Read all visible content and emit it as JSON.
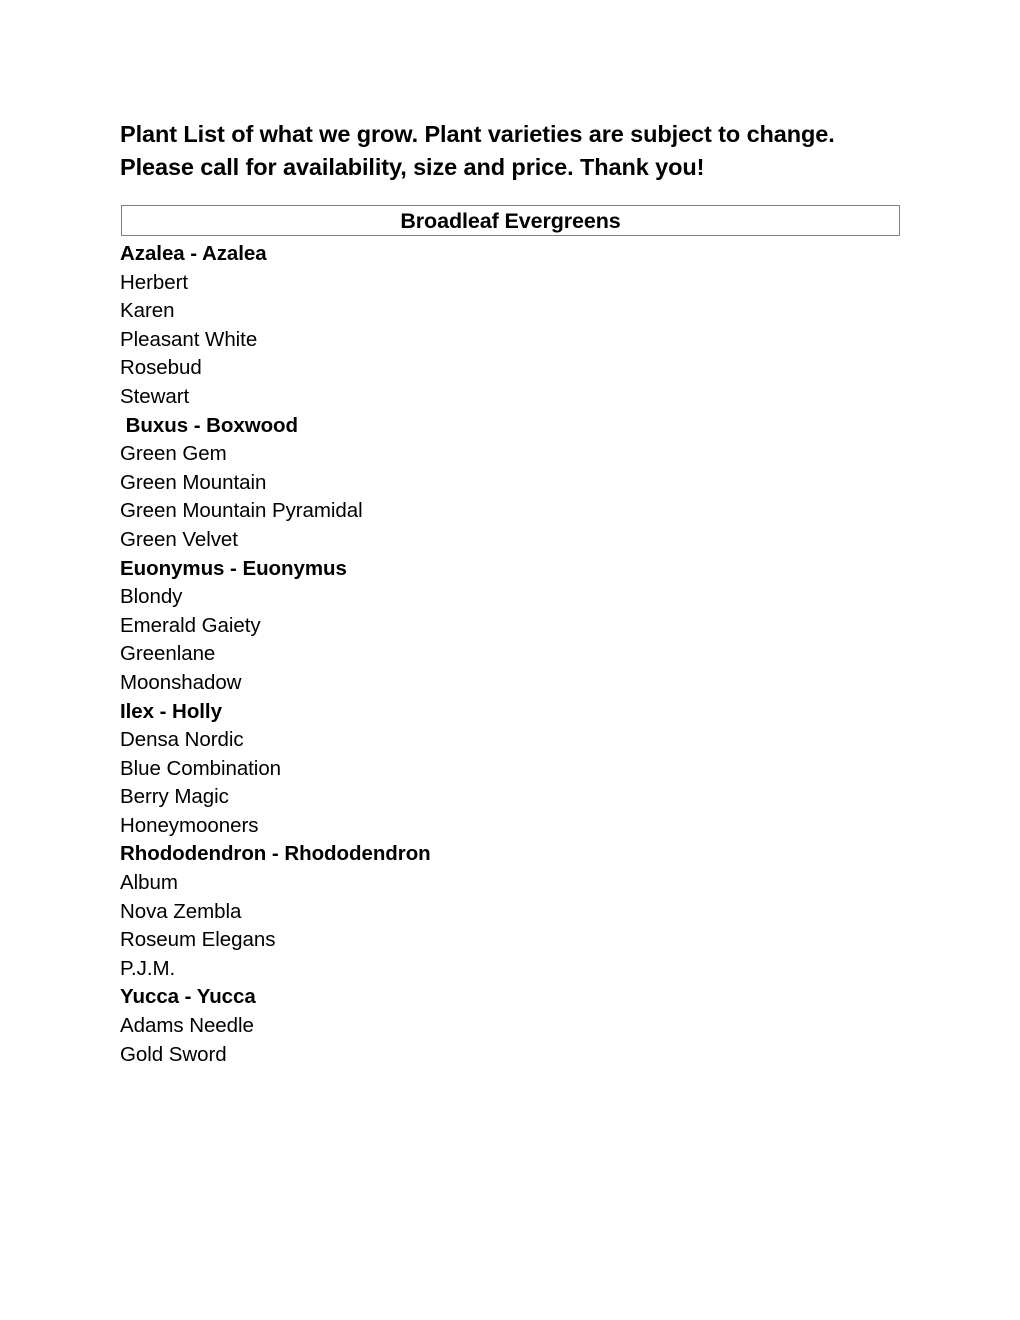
{
  "document": {
    "intro_lines": [
      "Plant List of what we grow. Plant varieties are subject to change.",
      "Please call for availability, size and price. Thank you!"
    ],
    "section_title": "Broadleaf Evergreens",
    "border_color": "#808080",
    "text_color": "#000000",
    "background_color": "#ffffff",
    "lines": [
      {
        "text": "Azalea - Azalea",
        "bold": true
      },
      {
        "text": "Herbert",
        "bold": false
      },
      {
        "text": "Karen",
        "bold": false
      },
      {
        "text": "Pleasant White",
        "bold": false
      },
      {
        "text": "Rosebud",
        "bold": false
      },
      {
        "text": "Stewart",
        "bold": false
      },
      {
        "text": " Buxus - Boxwood",
        "bold": true
      },
      {
        "text": "Green Gem",
        "bold": false
      },
      {
        "text": "Green Mountain",
        "bold": false
      },
      {
        "text": "Green Mountain Pyramidal",
        "bold": false
      },
      {
        "text": "Green Velvet",
        "bold": false
      },
      {
        "text": "Euonymus - Euonymus",
        "bold": true
      },
      {
        "text": "Blondy",
        "bold": false
      },
      {
        "text": "Emerald Gaiety",
        "bold": false
      },
      {
        "text": "Greenlane",
        "bold": false
      },
      {
        "text": "Moonshadow",
        "bold": false
      },
      {
        "text": "Ilex - Holly",
        "bold": true
      },
      {
        "text": "Densa Nordic",
        "bold": false
      },
      {
        "text": "Blue Combination",
        "bold": false
      },
      {
        "text": "Berry Magic",
        "bold": false
      },
      {
        "text": "Honeymooners",
        "bold": false
      },
      {
        "text": "Rhododendron - Rhododendron",
        "bold": true
      },
      {
        "text": "Album",
        "bold": false
      },
      {
        "text": "Nova Zembla",
        "bold": false
      },
      {
        "text": "Roseum Elegans",
        "bold": false
      },
      {
        "text": "P.J.M.",
        "bold": false
      },
      {
        "text": "Yucca - Yucca",
        "bold": true
      },
      {
        "text": "Adams Needle",
        "bold": false
      },
      {
        "text": "Gold Sword",
        "bold": false
      }
    ]
  }
}
